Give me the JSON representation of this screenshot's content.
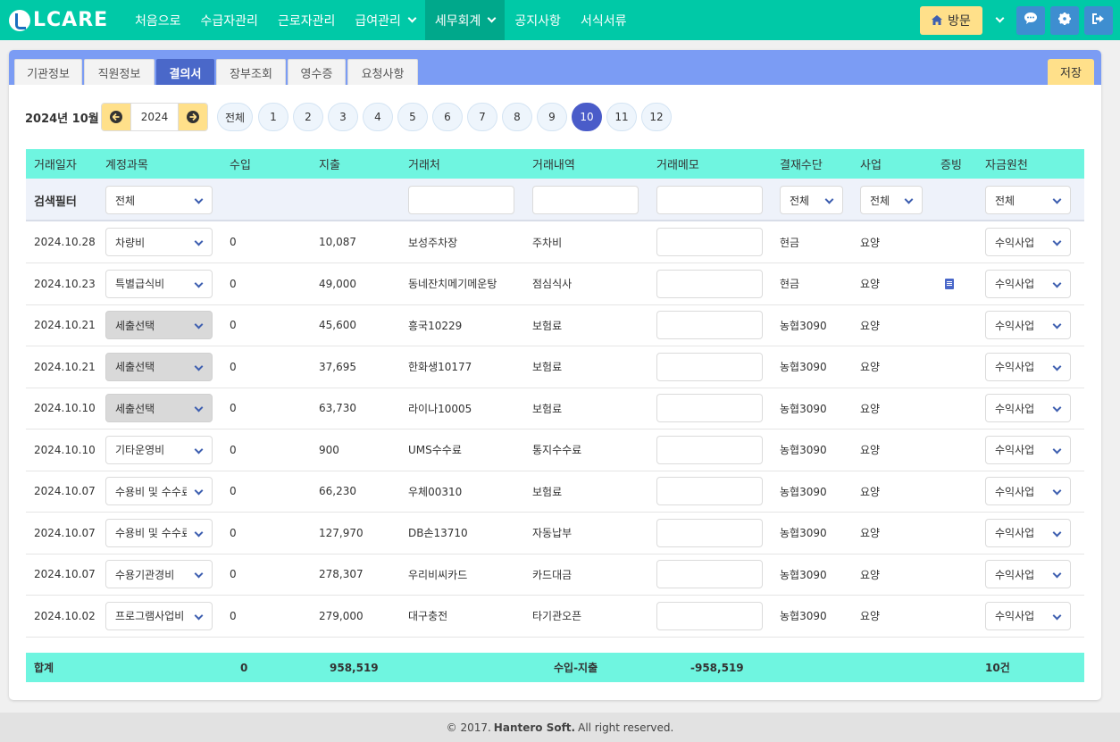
{
  "nav": {
    "logo": "LCARE",
    "menu": [
      "처음으로",
      "수급자관리",
      "근로자관리",
      "급여관리",
      "세무회계",
      "공지사항",
      "서식서류"
    ],
    "visit_label": "방문"
  },
  "tabs": [
    "기관정보",
    "직원정보",
    "결의서",
    "장부조회",
    "영수증",
    "요청사항"
  ],
  "save_label": "저장",
  "period": {
    "label": "2024년 10월",
    "year": "2024",
    "all_label": "전체",
    "months": [
      "1",
      "2",
      "3",
      "4",
      "5",
      "6",
      "7",
      "8",
      "9",
      "10",
      "11",
      "12"
    ],
    "selected_month": "10"
  },
  "table": {
    "headers": [
      "거래일자",
      "계정과목",
      "수입",
      "지출",
      "거래처",
      "거래내역",
      "거래메모",
      "결재수단",
      "사업",
      "증빙",
      "자금원천"
    ],
    "filter": {
      "label": "검색필터",
      "account": "전체",
      "payment": "전체",
      "business": "전체",
      "fund": "전체"
    },
    "rows": [
      {
        "date": "2024.10.28",
        "account": "차량비",
        "account_unset": false,
        "income": "0",
        "expense": "10,087",
        "vendor": "보성주차장",
        "detail": "주차비",
        "memo": "",
        "payment": "현금",
        "business": "요양",
        "proof": false,
        "fund": "수익사업"
      },
      {
        "date": "2024.10.23",
        "account": "특별급식비",
        "account_unset": false,
        "income": "0",
        "expense": "49,000",
        "vendor": "동네잔치메기메운탕",
        "detail": "점심식사",
        "memo": "",
        "payment": "현금",
        "business": "요양",
        "proof": true,
        "fund": "수익사업"
      },
      {
        "date": "2024.10.21",
        "account": "세출선택",
        "account_unset": true,
        "income": "0",
        "expense": "45,600",
        "vendor": "흥국10229",
        "detail": "보험료",
        "memo": "",
        "payment": "농협3090",
        "business": "요양",
        "proof": false,
        "fund": "수익사업"
      },
      {
        "date": "2024.10.21",
        "account": "세출선택",
        "account_unset": true,
        "income": "0",
        "expense": "37,695",
        "vendor": "한화생10177",
        "detail": "보험료",
        "memo": "",
        "payment": "농협3090",
        "business": "요양",
        "proof": false,
        "fund": "수익사업"
      },
      {
        "date": "2024.10.10",
        "account": "세출선택",
        "account_unset": true,
        "income": "0",
        "expense": "63,730",
        "vendor": "라이나10005",
        "detail": "보험료",
        "memo": "",
        "payment": "농협3090",
        "business": "요양",
        "proof": false,
        "fund": "수익사업"
      },
      {
        "date": "2024.10.10",
        "account": "기타운영비",
        "account_unset": false,
        "income": "0",
        "expense": "900",
        "vendor": "UMS수수료",
        "detail": "통지수수료",
        "memo": "",
        "payment": "농협3090",
        "business": "요양",
        "proof": false,
        "fund": "수익사업"
      },
      {
        "date": "2024.10.07",
        "account": "수용비 및 수수료",
        "account_unset": false,
        "income": "0",
        "expense": "66,230",
        "vendor": "우체00310",
        "detail": "보험료",
        "memo": "",
        "payment": "농협3090",
        "business": "요양",
        "proof": false,
        "fund": "수익사업"
      },
      {
        "date": "2024.10.07",
        "account": "수용비 및 수수료",
        "account_unset": false,
        "income": "0",
        "expense": "127,970",
        "vendor": "DB손13710",
        "detail": "자동납부",
        "memo": "",
        "payment": "농협3090",
        "business": "요양",
        "proof": false,
        "fund": "수익사업"
      },
      {
        "date": "2024.10.07",
        "account": "수용기관경비",
        "account_unset": false,
        "income": "0",
        "expense": "278,307",
        "vendor": "우리비씨카드",
        "detail": "카드대금",
        "memo": "",
        "payment": "농협3090",
        "business": "요양",
        "proof": false,
        "fund": "수익사업"
      },
      {
        "date": "2024.10.02",
        "account": "프로그램사업비",
        "account_unset": false,
        "income": "0",
        "expense": "279,000",
        "vendor": "대구충전",
        "detail": "타기관오픈",
        "memo": "",
        "payment": "농협3090",
        "business": "요양",
        "proof": false,
        "fund": "수익사업"
      }
    ],
    "total": {
      "label": "합계",
      "income": "0",
      "expense": "958,519",
      "diff_label": "수입-지출",
      "diff": "-958,519",
      "count": "10건"
    }
  },
  "footer": {
    "prefix": "© 2017.",
    "company": "Hantero Soft.",
    "suffix": "All right reserved."
  },
  "colors": {
    "nav": "#00c9a7",
    "tabbar": "#7b9cf4",
    "header_row": "#6ff5e0",
    "active": "#4a5cc9",
    "yellow": "#ffe08a"
  }
}
